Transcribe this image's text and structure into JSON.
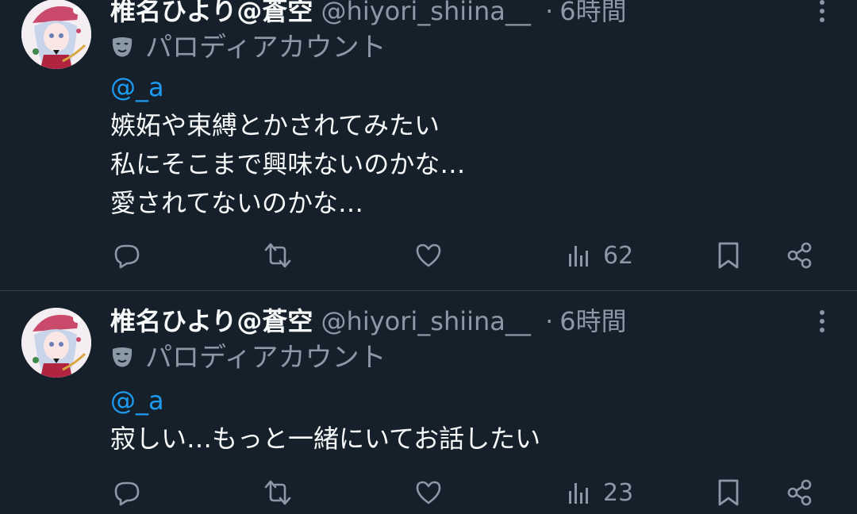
{
  "tweets": [
    {
      "name": "椎名ひより@蒼空",
      "handle": "@hiyori_shiina__",
      "dot": "·",
      "time": "6時間",
      "parody_label": "パロディアカウント",
      "mention": "@_a",
      "lines": [
        "嫉妬や束縛とかされてみたい",
        "私にそこまで興味ないのかな…",
        "愛されてないのかな…"
      ],
      "views": "62"
    },
    {
      "name": "椎名ひより@蒼空",
      "handle": "@hiyori_shiina__",
      "dot": "·",
      "time": "6時間",
      "parody_label": "パロディアカウント",
      "mention": "@_a",
      "lines": [
        "寂しい…もっと一緒にいてお話したい"
      ],
      "views": "23"
    }
  ],
  "icons": {
    "more": "more-vertical-icon",
    "parody": "mask-icon",
    "reply": "reply-icon",
    "retweet": "retweet-icon",
    "like": "heart-icon",
    "views": "views-bar-chart-icon",
    "bookmark": "bookmark-icon",
    "share": "share-icon"
  },
  "colors": {
    "background": "#15202b",
    "text": "#f7f9f9",
    "muted": "#8b98a5",
    "link": "#1d9bf0",
    "divider": "#38444d"
  }
}
